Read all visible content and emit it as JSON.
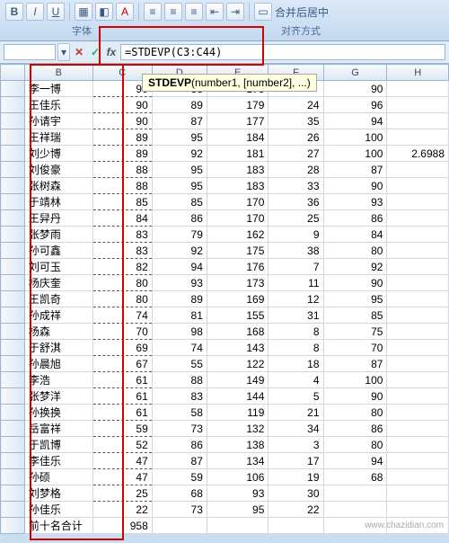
{
  "ribbon": {
    "group_font": "字体",
    "group_align": "对齐方式",
    "merge_label": "合并后居中"
  },
  "formula_bar": {
    "input": "=STDEVP(C3:C44)"
  },
  "tooltip": {
    "fn": "STDEVP",
    "sig": "(number1, [number2], ...)"
  },
  "cols": [
    "B",
    "C",
    "D",
    "E",
    "F",
    "G",
    "H"
  ],
  "rows": [
    {
      "b": "李一博",
      "c": 90,
      "d": 88,
      "e": 178,
      "g": 90
    },
    {
      "b": "王佳乐",
      "c": 90,
      "d": 89,
      "e": 179,
      "f": 24,
      "g": 96
    },
    {
      "b": "孙请宇",
      "c": 90,
      "d": 87,
      "e": 177,
      "f": 35,
      "g": 94
    },
    {
      "b": "王祥瑞",
      "c": 89,
      "d": 95,
      "e": 184,
      "f": 26,
      "g": 100
    },
    {
      "b": "刘少博",
      "c": 89,
      "d": 92,
      "e": 181,
      "f": 27,
      "g": 100,
      "h": "2.6988"
    },
    {
      "b": "刘俊豪",
      "c": 88,
      "d": 95,
      "e": 183,
      "f": 28,
      "g": 87
    },
    {
      "b": "张树森",
      "c": 88,
      "d": 95,
      "e": 183,
      "f": 33,
      "g": 90
    },
    {
      "b": "于靖林",
      "c": 85,
      "d": 85,
      "e": 170,
      "f": 36,
      "g": 93
    },
    {
      "b": "王舁丹",
      "c": 84,
      "d": 86,
      "e": 170,
      "f": 25,
      "g": 86
    },
    {
      "b": "张梦雨",
      "c": 83,
      "d": 79,
      "e": 162,
      "f": 9,
      "g": 84
    },
    {
      "b": "孙可鑫",
      "c": 83,
      "d": 92,
      "e": 175,
      "f": 38,
      "g": 80
    },
    {
      "b": "刘可玉",
      "c": 82,
      "d": 94,
      "e": 176,
      "f": 7,
      "g": 92
    },
    {
      "b": "杨庆奎",
      "c": 80,
      "d": 93,
      "e": 173,
      "f": 11,
      "g": 90
    },
    {
      "b": "王凯奇",
      "c": 80,
      "d": 89,
      "e": 169,
      "f": 12,
      "g": 95
    },
    {
      "b": "孙成祥",
      "c": 74,
      "d": 81,
      "e": 155,
      "f": 31,
      "g": 85
    },
    {
      "b": "杨森",
      "c": 70,
      "d": 98,
      "e": 168,
      "f": 8,
      "g": 75
    },
    {
      "b": "于舒淇",
      "c": 69,
      "d": 74,
      "e": 143,
      "f": 8,
      "g": 70
    },
    {
      "b": "孙晨旭",
      "c": 67,
      "d": 55,
      "e": 122,
      "f": 18,
      "g": 87
    },
    {
      "b": "李浩",
      "c": 61,
      "d": 88,
      "e": 149,
      "f": 4,
      "g": 100
    },
    {
      "b": "张梦洋",
      "c": 61,
      "d": 83,
      "e": 144,
      "f": 5,
      "g": 90
    },
    {
      "b": "孙换换",
      "c": 61,
      "d": 58,
      "e": 119,
      "f": 21,
      "g": 80
    },
    {
      "b": "岳富祥",
      "c": 59,
      "d": 73,
      "e": 132,
      "f": 34,
      "g": 86
    },
    {
      "b": "于凯博",
      "c": 52,
      "d": 86,
      "e": 138,
      "f": 3,
      "g": 80
    },
    {
      "b": "李佳乐",
      "c": 47,
      "d": 87,
      "e": 134,
      "f": 17,
      "g": 94
    },
    {
      "b": "孙硕",
      "c": 47,
      "d": 59,
      "e": 106,
      "f": 19,
      "g": 68
    },
    {
      "b": "刘梦格",
      "c": 25,
      "d": 68,
      "e": 93,
      "f": 30
    },
    {
      "b": "孙佳乐",
      "c": 22,
      "d": 73,
      "e": 95,
      "f": 22
    }
  ],
  "footer": {
    "label": "前十名合计",
    "c": 958
  },
  "watermark": "www.chazidian.com",
  "corner_note": "2.6988"
}
